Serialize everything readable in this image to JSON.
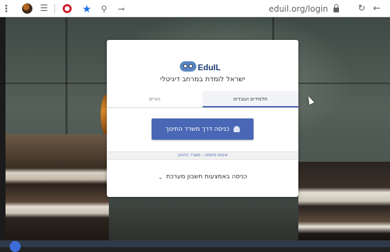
{
  "browser": {
    "url": "eduil.org/login",
    "icons": {
      "menu": "kebab-menu-icon",
      "extension_avatar": "avatar-extension-icon",
      "reader": "reader-mode-icon",
      "opera": "opera-extension-icon",
      "bookmark": "star-icon",
      "search": "search-icon",
      "key": "key-icon",
      "lock": "lock-icon",
      "reload": "reload-icon",
      "back": "back-arrow-icon"
    },
    "glyphs": {
      "menu": "⋮",
      "reader": "☰",
      "star": "★",
      "search": "⚲",
      "key": "⊸",
      "reload": "↻",
      "back": "←"
    }
  },
  "login": {
    "logo_text": "EduIL",
    "tagline": "ישראל לומדת במרחב דיגיטלי",
    "tabs": [
      {
        "label": "הורים",
        "active": false
      },
      {
        "label": "תלמידים ועובדים",
        "active": true
      }
    ],
    "ministry_button": "כניסה דרך משרד החינוך",
    "reset_link": "איפוס סיסמה - משרד החינוך",
    "system_login": "כניסה באמצעות חשבון מערכת",
    "chevron": "⌄"
  },
  "colors": {
    "accent": "#4a67b5",
    "brand_dark": "#1f3b73",
    "bookmark_star": "#1a73e8",
    "opera_red": "#cc1b2b"
  }
}
